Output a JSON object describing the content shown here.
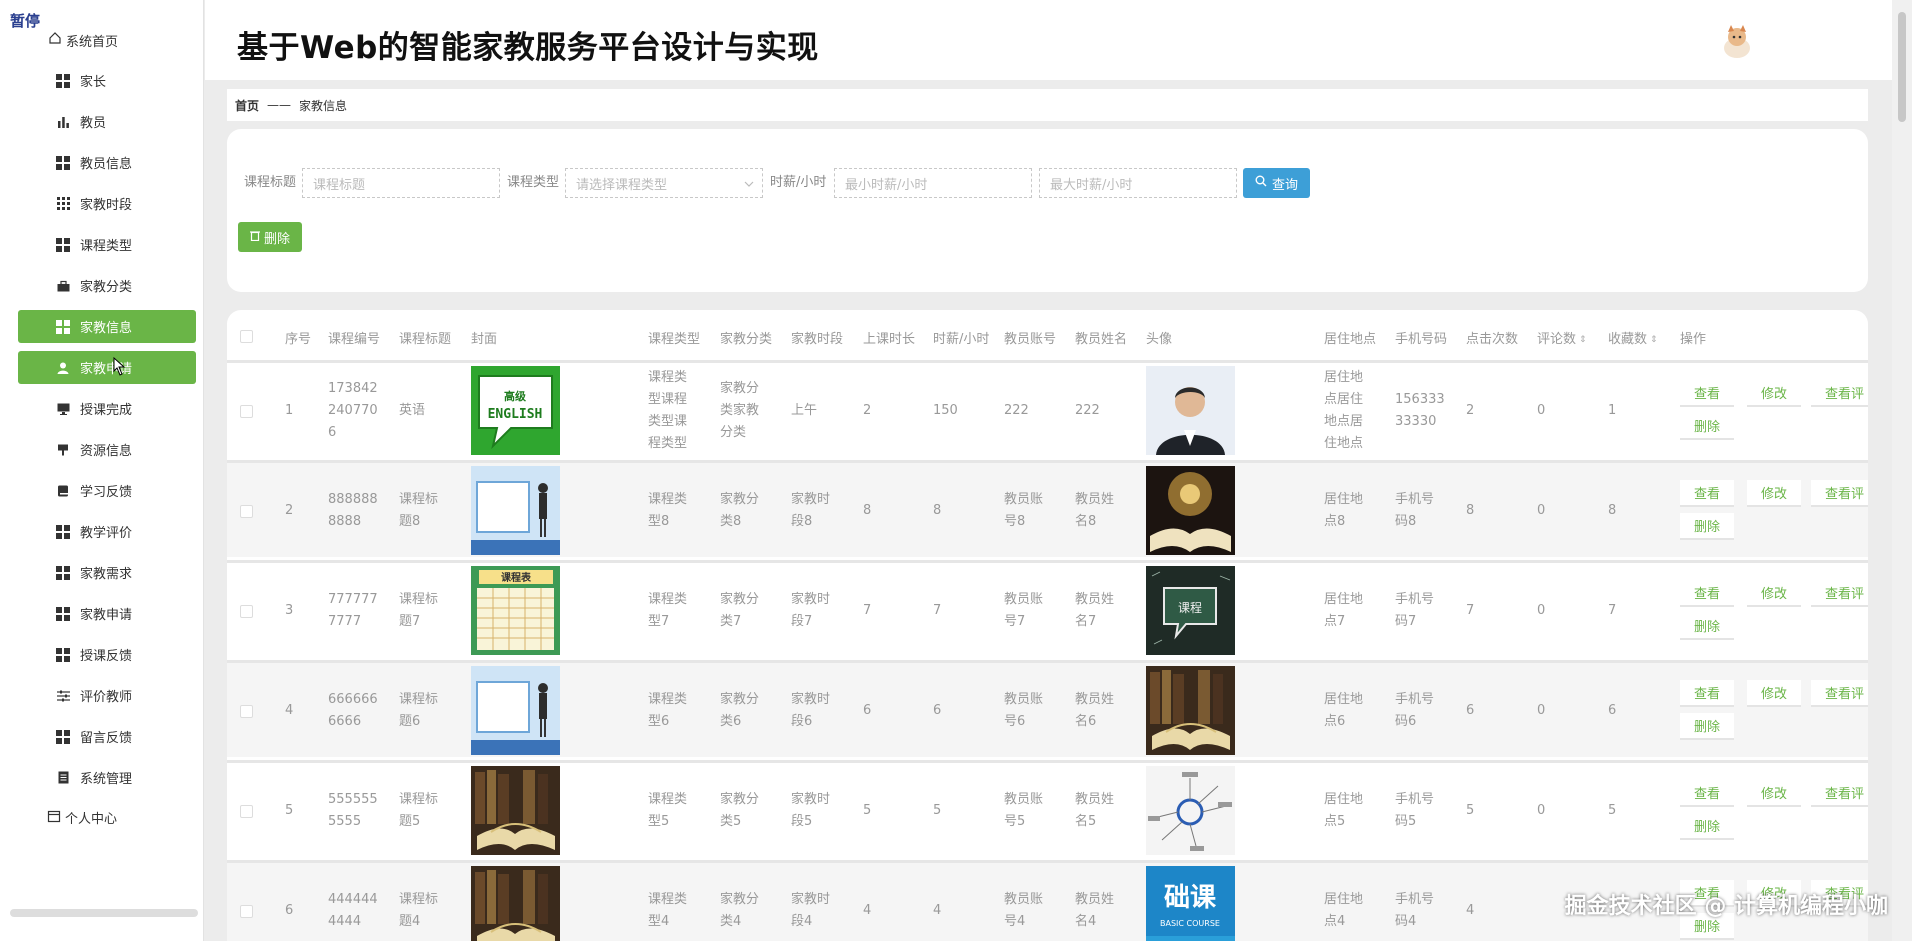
{
  "app": {
    "title": "基于Web的智能家教服务平台设计与实现",
    "pause_tag": "暂停"
  },
  "sidebar": {
    "home": "系统首页",
    "items": [
      {
        "label": "家长",
        "icon": "grid-icon",
        "active": false
      },
      {
        "label": "教员",
        "icon": "bar-chart-icon",
        "active": false
      },
      {
        "label": "教员信息",
        "icon": "grid-icon",
        "active": false
      },
      {
        "label": "家教时段",
        "icon": "grid9-icon",
        "active": false
      },
      {
        "label": "课程类型",
        "icon": "grid-icon",
        "active": false
      },
      {
        "label": "家教分类",
        "icon": "briefcase-icon",
        "active": false
      },
      {
        "label": "家教信息",
        "icon": "grid-icon",
        "active": true
      },
      {
        "label": "家教申请",
        "icon": "user-icon",
        "active": true
      },
      {
        "label": "授课完成",
        "icon": "monitor-icon",
        "active": false
      },
      {
        "label": "资源信息",
        "icon": "pin-icon",
        "active": false
      },
      {
        "label": "学习反馈",
        "icon": "book-icon",
        "active": false
      },
      {
        "label": "教学评价",
        "icon": "grid-icon",
        "active": false
      },
      {
        "label": "家教需求",
        "icon": "grid-icon",
        "active": false
      },
      {
        "label": "家教申请",
        "icon": "grid-icon",
        "active": false
      },
      {
        "label": "授课反馈",
        "icon": "grid-icon",
        "active": false
      },
      {
        "label": "评价教师",
        "icon": "sliders-icon",
        "active": false
      },
      {
        "label": "留言反馈",
        "icon": "grid-icon",
        "active": false
      },
      {
        "label": "系统管理",
        "icon": "doc-icon",
        "active": false
      }
    ],
    "personal": "个人中心"
  },
  "breadcrumb": {
    "home": "首页",
    "sep": "——",
    "current": "家教信息"
  },
  "search": {
    "title_label": "课程标题",
    "title_placeholder": "课程标题",
    "type_label": "课程类型",
    "type_placeholder": "请选择课程类型",
    "wage_label": "时薪/小时",
    "min_placeholder": "最小时薪/小时",
    "max_placeholder": "最大时薪/小时",
    "query_button": "查询",
    "delete_button": "删除"
  },
  "table": {
    "headers": {
      "index": "序号",
      "code": "课程编号",
      "title": "课程标题",
      "cover": "封面",
      "type": "课程类型",
      "category": "家教分类",
      "period": "家教时段",
      "duration": "上课时长",
      "wage": "时薪/小时",
      "account": "教员账号",
      "name": "教员姓名",
      "avatar": "头像",
      "address": "居住地点",
      "phone": "手机号码",
      "clicks": "点击次数",
      "comments": "评论数",
      "favorites": "收藏数",
      "ops": "操作"
    },
    "actions": {
      "view": "查看",
      "edit": "修改",
      "review": "查看评",
      "delete": "删除"
    },
    "rows": [
      {
        "index": "1",
        "code": [
          "173842",
          "240770",
          "6"
        ],
        "title": [
          "英语"
        ],
        "type": [
          "课程类",
          "型课程",
          "类型课",
          "程类型"
        ],
        "category": [
          "家教分",
          "类家教",
          "分类"
        ],
        "period": [
          "上午"
        ],
        "duration": "2",
        "wage": "150",
        "account": [
          "222"
        ],
        "name": [
          "222"
        ],
        "address": [
          "居住地",
          "点居住",
          "地点居",
          "住地点"
        ],
        "phone": [
          "156333",
          "33330"
        ],
        "clicks": "2",
        "comments": "0",
        "favorites": "1",
        "cover": "english",
        "avatar": "teacher"
      },
      {
        "index": "2",
        "code": [
          "888888",
          "8888"
        ],
        "title": [
          "课程标",
          "题8"
        ],
        "type": [
          "课程类",
          "型8"
        ],
        "category": [
          "家教分",
          "类8"
        ],
        "period": [
          "家教时",
          "段8"
        ],
        "duration": "8",
        "wage": "8",
        "account": [
          "教员账",
          "号8"
        ],
        "name": [
          "教员姓",
          "名8"
        ],
        "address": [
          "居住地",
          "点8"
        ],
        "phone": [
          "手机号",
          "码8"
        ],
        "clicks": "8",
        "comments": "0",
        "favorites": "8",
        "cover": "board",
        "avatar": "book-light"
      },
      {
        "index": "3",
        "code": [
          "777777",
          "7777"
        ],
        "title": [
          "课程标",
          "题7"
        ],
        "type": [
          "课程类",
          "型7"
        ],
        "category": [
          "家教分",
          "类7"
        ],
        "period": [
          "家教时",
          "段7"
        ],
        "duration": "7",
        "wage": "7",
        "account": [
          "教员账",
          "号7"
        ],
        "name": [
          "教员姓",
          "名7"
        ],
        "address": [
          "居住地",
          "点7"
        ],
        "phone": [
          "手机号",
          "码7"
        ],
        "clicks": "7",
        "comments": "0",
        "favorites": "7",
        "cover": "schedule",
        "avatar": "chalk"
      },
      {
        "index": "4",
        "code": [
          "666666",
          "6666"
        ],
        "title": [
          "课程标",
          "题6"
        ],
        "type": [
          "课程类",
          "型6"
        ],
        "category": [
          "家教分",
          "类6"
        ],
        "period": [
          "家教时",
          "段6"
        ],
        "duration": "6",
        "wage": "6",
        "account": [
          "教员账",
          "号6"
        ],
        "name": [
          "教员姓",
          "名6"
        ],
        "address": [
          "居住地",
          "点6"
        ],
        "phone": [
          "手机号",
          "码6"
        ],
        "clicks": "6",
        "comments": "0",
        "favorites": "6",
        "cover": "board",
        "avatar": "books"
      },
      {
        "index": "5",
        "code": [
          "555555",
          "5555"
        ],
        "title": [
          "课程标",
          "题5"
        ],
        "type": [
          "课程类",
          "型5"
        ],
        "category": [
          "家教分",
          "类5"
        ],
        "period": [
          "家教时",
          "段5"
        ],
        "duration": "5",
        "wage": "5",
        "account": [
          "教员账",
          "号5"
        ],
        "name": [
          "教员姓",
          "名5"
        ],
        "address": [
          "居住地",
          "点5"
        ],
        "phone": [
          "手机号",
          "码5"
        ],
        "clicks": "5",
        "comments": "0",
        "favorites": "5",
        "cover": "books",
        "avatar": "mindmap"
      },
      {
        "index": "6",
        "code": [
          "444444",
          "4444"
        ],
        "title": [
          "课程标",
          "题4"
        ],
        "type": [
          "课程类",
          "型4"
        ],
        "category": [
          "家教分",
          "类4"
        ],
        "period": [
          "家教时",
          "段4"
        ],
        "duration": "4",
        "wage": "4",
        "account": [
          "教员账",
          "号4"
        ],
        "name": [
          "教员姓",
          "名4"
        ],
        "address": [
          "居住地",
          "点4"
        ],
        "phone": [
          "手机号",
          "码4"
        ],
        "clicks": "4",
        "comments": "",
        "favorites": "",
        "cover": "books",
        "avatar": "basic"
      }
    ]
  },
  "overlay": {
    "watermark": "掘金技术社区 @ 计算机编程小咖",
    "avatar_caption": "BASIC COURSE",
    "avatar_text": "础课"
  },
  "colors": {
    "primary_green": "#6ab547",
    "query_blue": "#3d9fd7"
  }
}
